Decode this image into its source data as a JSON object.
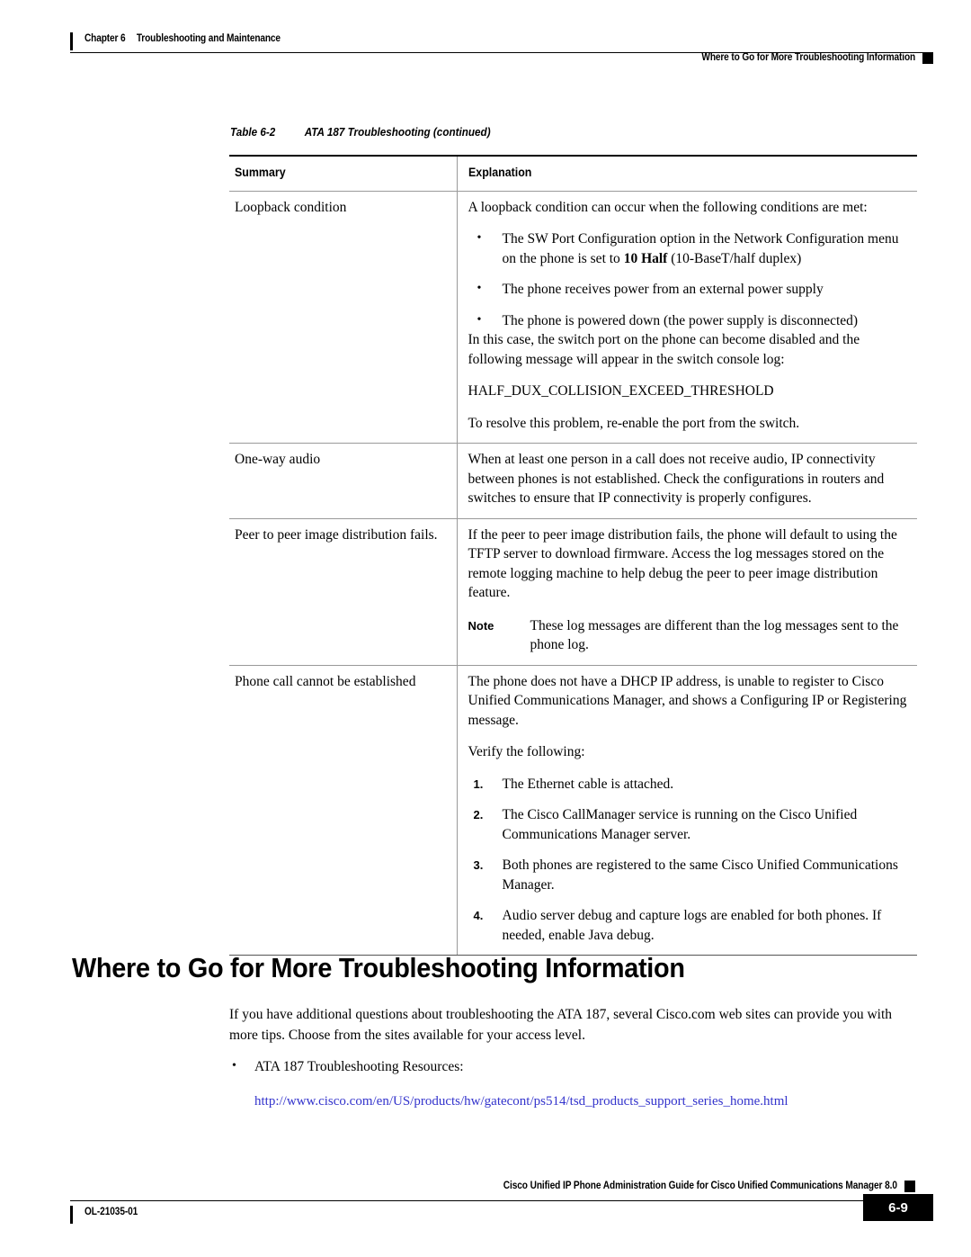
{
  "header": {
    "chapter_label": "Chapter 6",
    "chapter_title": "Troubleshooting and Maintenance",
    "running_head": "Where to Go for More Troubleshooting Information"
  },
  "table": {
    "caption_label": "Table 6-2",
    "caption_title": "ATA 187 Troubleshooting (continued)",
    "columns": [
      "Summary",
      "Explanation"
    ],
    "rows": [
      {
        "summary": "Loopback condition",
        "intro": "A loopback condition can occur when the following conditions are met:",
        "bullets": [
          "The SW Port Configuration option in the Network Configuration menu on the phone is set to ",
          "The phone receives power from an external power supply",
          "The phone is powered down (the power supply is disconnected)"
        ],
        "bullet1_bold": "10 Half",
        "bullet1_tail": " (10-BaseT/half duplex)",
        "para2": "In this case, the switch port on the phone can become disabled and the following message will appear in the switch console log:",
        "code": "HALF_DUX_COLLISION_EXCEED_THRESHOLD",
        "para3": "To resolve this problem, re-enable the port from the switch."
      },
      {
        "summary": "One-way audio",
        "explanation": "When at least one person in a call does not receive audio, IP connectivity between phones is not established. Check the configurations in routers and switches to ensure that IP connectivity is properly configures."
      },
      {
        "summary": "Peer to peer image distribution fails.",
        "explanation": "If the peer to peer image distribution fails, the phone will default to using the TFTP server to download firmware. Access the log messages stored on the remote logging machine to help debug the peer to peer image distribution feature.",
        "note_label": "Note",
        "note_text": "These log messages are different than the log messages sent to the phone log."
      },
      {
        "summary": "Phone call cannot be established",
        "explanation": "The phone does not have a DHCP IP address, is unable to register to Cisco Unified Communications Manager, and shows a Configuring IP or Registering message.",
        "verify_intro": "Verify the following:",
        "steps": [
          "The Ethernet cable is attached.",
          "The Cisco CallManager service is running on the Cisco Unified Communications Manager server.",
          "Both phones are registered to the same Cisco Unified Communications Manager.",
          "Audio server debug and capture logs are enabled for both phones. If needed, enable Java debug."
        ],
        "step_numbers": [
          "1.",
          "2.",
          "3.",
          "4."
        ]
      }
    ]
  },
  "section": {
    "heading": "Where to Go for More Troubleshooting Information",
    "intro": "If you have additional questions about troubleshooting the ATA 187, several Cisco.com web sites can provide you with more tips. Choose from the sites available for your access level.",
    "bullet": "ATA 187 Troubleshooting Resources:",
    "url": "http://www.cisco.com/en/US/products/hw/gatecont/ps514/tsd_products_support_series_home.html",
    "url_color": "#3333cc"
  },
  "footer": {
    "guide_title": "Cisco Unified IP Phone Administration Guide for Cisco Unified Communications Manager 8.0",
    "doc_id": "OL-21035-01",
    "page_number": "6-9"
  },
  "bullet_glyph": "•"
}
